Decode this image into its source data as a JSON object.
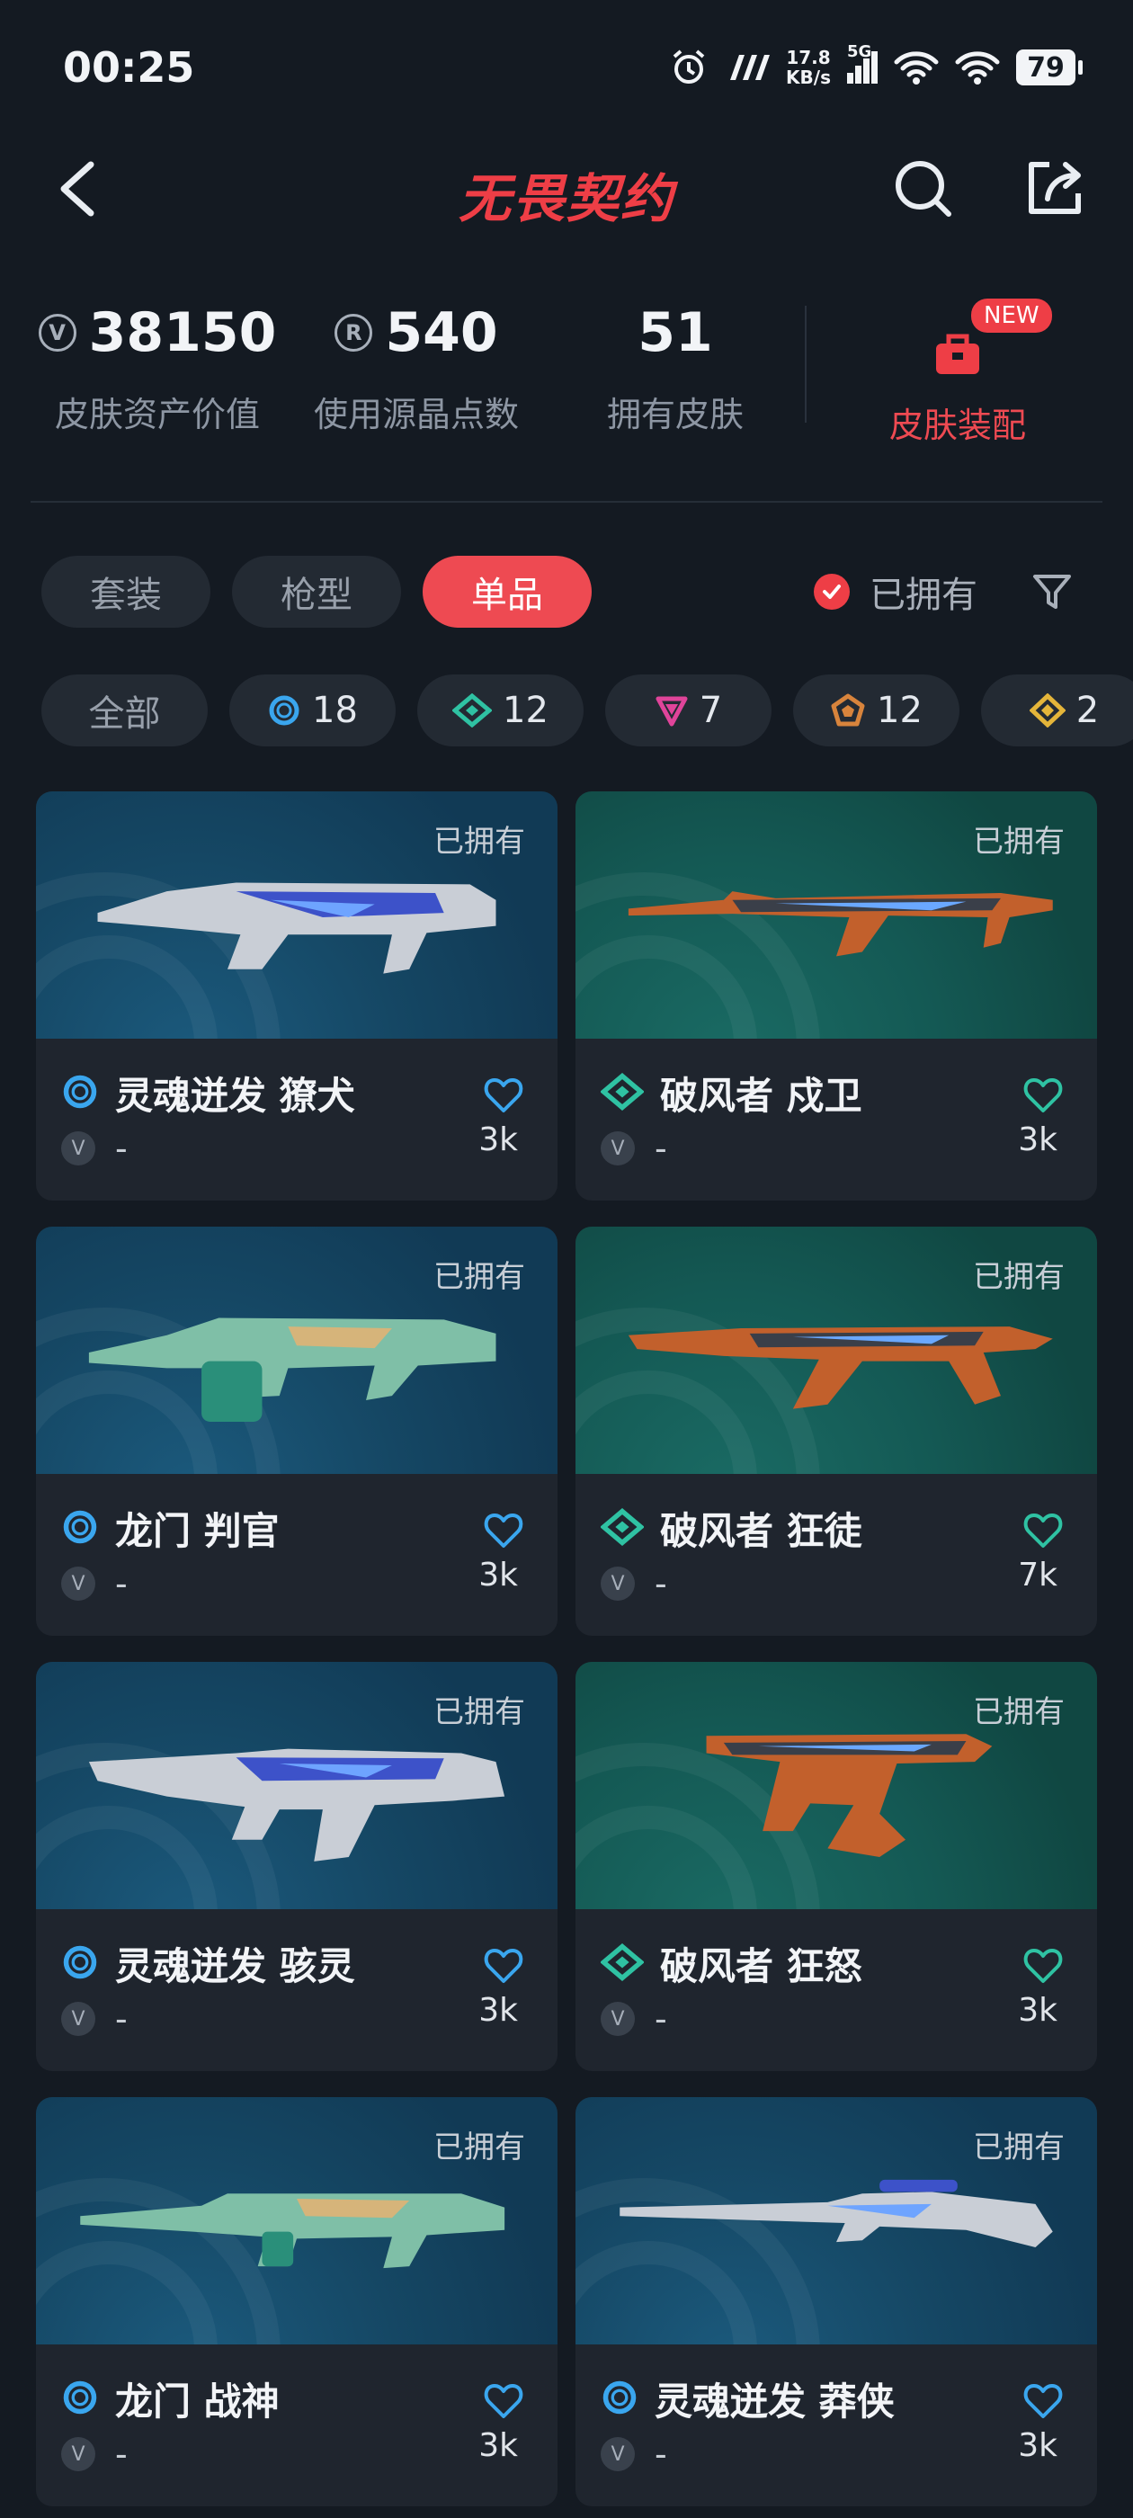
{
  "status_bar": {
    "time": "00:25",
    "speed_value": "17.8",
    "speed_unit": "KB/s",
    "network": "5G",
    "battery": "79"
  },
  "header": {
    "title": "无畏契约"
  },
  "stats": {
    "asset_value": "38150",
    "asset_label": "皮肤资产价值",
    "points": "540",
    "points_label": "使用源晶点数",
    "skins_count": "51",
    "skins_label": "拥有皮肤",
    "equip_label": "皮肤装配",
    "new_badge": "NEW"
  },
  "tabs": {
    "set": "套装",
    "gun": "枪型",
    "single": "单品",
    "owned_toggle": "已拥有"
  },
  "chips": {
    "all": "全部",
    "blue": "18",
    "green": "12",
    "pink": "7",
    "orange": "12",
    "gold": "2"
  },
  "colors": {
    "accent": "#ee3e46",
    "tier_blue": "#3aa6ee",
    "tier_green": "#2fc2a3",
    "tier_pink": "#e0449a",
    "tier_orange": "#d8843c",
    "tier_gold": "#e4b53a"
  },
  "cards": [
    {
      "owned": "已拥有",
      "name": "灵魂迸发 獠犬",
      "price": "-",
      "likes": "3k",
      "tier": "blue"
    },
    {
      "owned": "已拥有",
      "name": "破风者 戍卫",
      "price": "-",
      "likes": "3k",
      "tier": "green"
    },
    {
      "owned": "已拥有",
      "name": "龙门 判官",
      "price": "-",
      "likes": "3k",
      "tier": "blue"
    },
    {
      "owned": "已拥有",
      "name": "破风者 狂徒",
      "price": "-",
      "likes": "7k",
      "tier": "green"
    },
    {
      "owned": "已拥有",
      "name": "灵魂迸发 骇灵",
      "price": "-",
      "likes": "3k",
      "tier": "blue"
    },
    {
      "owned": "已拥有",
      "name": "破风者 狂怒",
      "price": "-",
      "likes": "3k",
      "tier": "green"
    },
    {
      "owned": "已拥有",
      "name": "龙门 战神",
      "price": "-",
      "likes": "3k",
      "tier": "blue"
    },
    {
      "owned": "已拥有",
      "name": "灵魂迸发 莽侠",
      "price": "-",
      "likes": "3k",
      "tier": "blue"
    }
  ]
}
